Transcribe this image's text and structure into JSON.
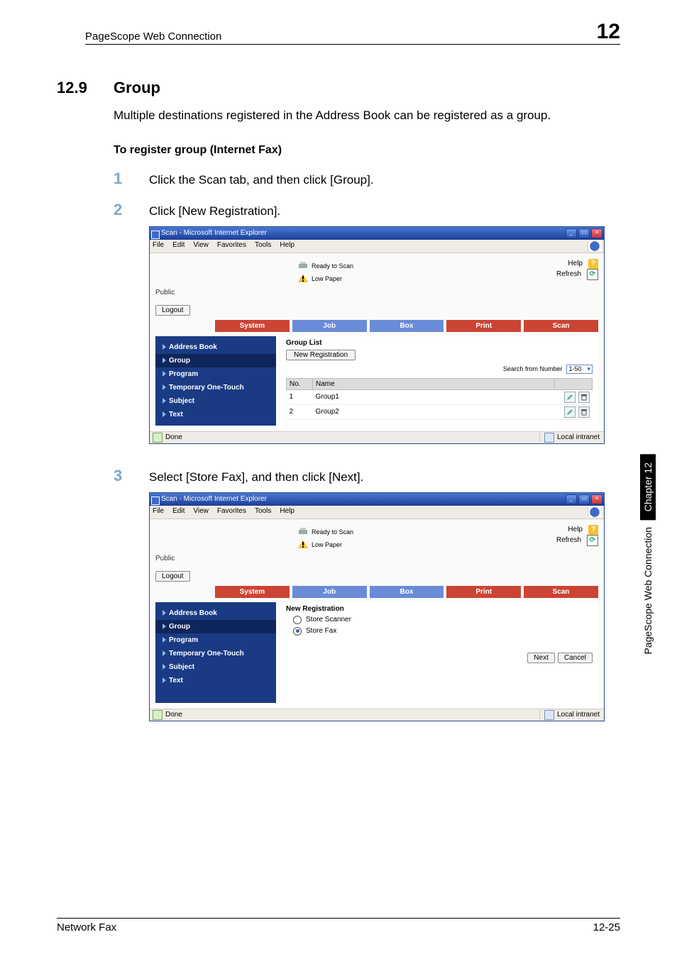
{
  "header": {
    "title": "PageScope Web Connection",
    "chapter_num": "12"
  },
  "section": {
    "number": "12.9",
    "title": "Group",
    "intro": "Multiple destinations registered in the Address Book can be registered as a group.",
    "subhead": "To register group (Internet Fax)"
  },
  "steps": {
    "s1_num": "1",
    "s1_text": "Click the Scan tab, and then click [Group].",
    "s2_num": "2",
    "s2_text": "Click [New Registration].",
    "s3_num": "3",
    "s3_text": "Select [Store Fax], and then click [Next]."
  },
  "ie": {
    "title": "Scan - Microsoft Internet Explorer",
    "menu": {
      "file": "File",
      "edit": "Edit",
      "view": "View",
      "fav": "Favorites",
      "tools": "Tools",
      "help": "Help"
    },
    "status_ready": "Ready to Scan",
    "status_low": "Low Paper",
    "help": "Help",
    "refresh": "Refresh",
    "public": "Public",
    "logout": "Logout",
    "tabs": {
      "system": "System",
      "job": "Job",
      "box": "Box",
      "print": "Print",
      "scan": "Scan"
    },
    "sidebar": {
      "ab": "Address Book",
      "group": "Group",
      "program": "Program",
      "tot": "Temporary One-Touch",
      "subject": "Subject",
      "text": "Text"
    },
    "group_panel": {
      "title": "Group List",
      "newreg": "New Registration",
      "search_label": "Search from Number",
      "search_range": "1-50",
      "col_no": "No.",
      "col_name": "Name",
      "rows": [
        {
          "no": "1",
          "name": "Group1"
        },
        {
          "no": "2",
          "name": "Group2"
        }
      ]
    },
    "newreg_panel": {
      "title": "New Registration",
      "opt_scanner": "Store Scanner",
      "opt_fax": "Store Fax",
      "next": "Next",
      "cancel": "Cancel"
    },
    "status_done": "Done",
    "status_zone": "Local intranet"
  },
  "side": {
    "chapter": "Chapter 12",
    "text": "PageScope Web Connection"
  },
  "footer": {
    "left": "Network Fax",
    "right": "12-25"
  }
}
